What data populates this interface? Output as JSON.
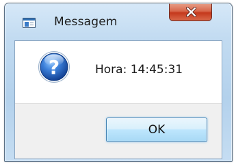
{
  "dialog": {
    "title": "Messagem",
    "message": "Hora: 14:45:31",
    "ok_label": "OK",
    "icon": "question-icon",
    "close_icon": "close-icon",
    "app_icon": "window-icon"
  },
  "colors": {
    "title_bar": "#c2dbf1",
    "close_button": "#c5381c",
    "ok_button": "#bee6fd",
    "footer": "#f0f0f0",
    "question_icon": "#1f59b4"
  }
}
